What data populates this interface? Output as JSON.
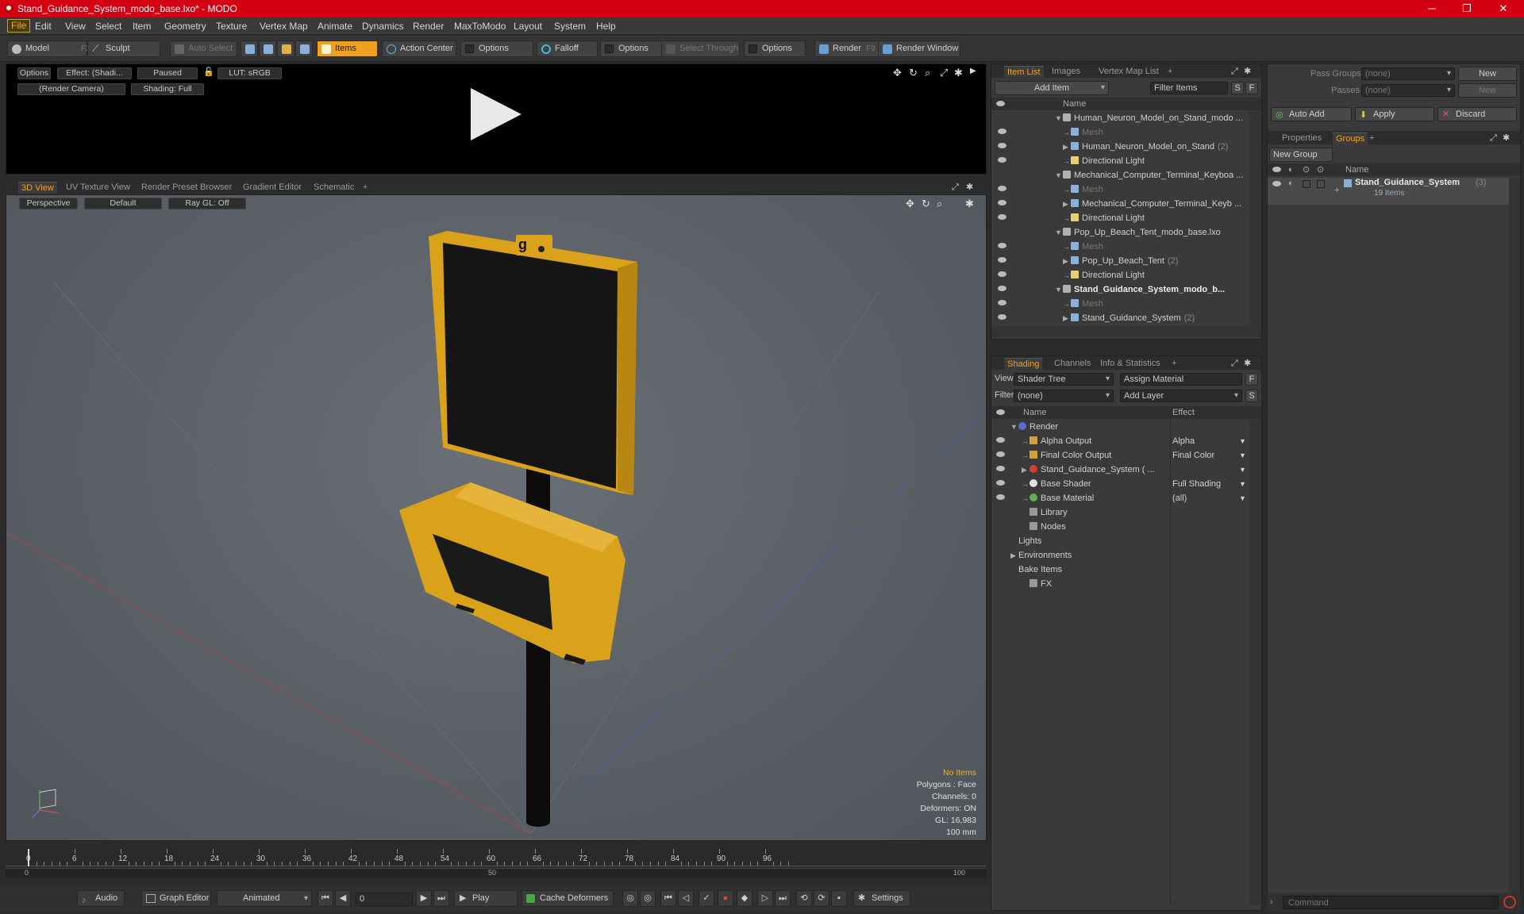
{
  "window": {
    "title": "Stand_Guidance_System_modo_base.lxo* - MODO",
    "min": "─",
    "max": "❐",
    "close": "✕"
  },
  "menu": [
    "File",
    "Edit",
    "View",
    "Select",
    "Item",
    "Geometry",
    "Texture",
    "Vertex Map",
    "Animate",
    "Dynamics",
    "Render",
    "MaxToModo",
    "Layout",
    "System",
    "Help"
  ],
  "toolbar": {
    "model": "Model",
    "model_key": "F2",
    "sculpt": "Sculpt",
    "auto_select": "Auto Select",
    "items": "Items",
    "action_center": "Action Center",
    "options1": "Options",
    "falloff": "Falloff",
    "options2": "Options",
    "select_through": "Select Through",
    "options3": "Options",
    "render": "Render",
    "render_key": "F9",
    "render_window": "Render Window"
  },
  "render_view": {
    "options": "Options",
    "effect": "Effect: (Shadi...",
    "paused": "Paused",
    "lut": "LUT: sRGB",
    "camera": "(Render Camera)",
    "shading": "Shading: Full"
  },
  "view_tabs": [
    "3D View",
    "UV Texture View",
    "Render Preset Browser",
    "Gradient Editor",
    "Schematic"
  ],
  "view3d": {
    "perspective": "Perspective",
    "default": "Default",
    "raygl": "Ray GL: Off",
    "stats": {
      "no_items": "No Items",
      "polygons": "Polygons : Face",
      "channels": "Channels: 0",
      "deformers": "Deformers: ON",
      "gl": "GL: 16,983",
      "scale": "100 mm"
    }
  },
  "timeline": {
    "ticks": [
      "0",
      "6",
      "12",
      "18",
      "24",
      "30",
      "36",
      "42",
      "48",
      "54",
      "60",
      "66",
      "72",
      "78",
      "84",
      "90",
      "96"
    ],
    "sub_start": "0",
    "sub_mid": "50",
    "sub_end": "100"
  },
  "bottom": {
    "audio": "Audio",
    "graph_editor": "Graph Editor",
    "animated": "Animated",
    "frame": "0",
    "play": "Play",
    "cache": "Cache Deformers",
    "settings": "Settings"
  },
  "item_list": {
    "tabs": [
      "Item List",
      "Images",
      "Vertex Map List"
    ],
    "add_item": "Add Item",
    "filter_items": "Filter Items",
    "s": "S",
    "f": "F",
    "col_name": "Name",
    "rows": [
      {
        "label": "Human_Neuron_Model_on_Stand_modo ...",
        "indent": 0,
        "type": "scene",
        "bold": false
      },
      {
        "label": "Mesh",
        "indent": 1,
        "type": "mesh",
        "bold": false
      },
      {
        "label": "Human_Neuron_Model_on_Stand",
        "count": "(2)",
        "indent": 1,
        "type": "group",
        "bold": false
      },
      {
        "label": "Directional Light",
        "indent": 1,
        "type": "light",
        "bold": false
      },
      {
        "label": "Mechanical_Computer_Terminal_Keyboa ...",
        "indent": 0,
        "type": "scene",
        "bold": false
      },
      {
        "label": "Mesh",
        "indent": 1,
        "type": "mesh",
        "bold": false
      },
      {
        "label": "Mechanical_Computer_Terminal_Keyb ...",
        "indent": 1,
        "type": "group",
        "bold": false
      },
      {
        "label": "Directional Light",
        "indent": 1,
        "type": "light",
        "bold": false
      },
      {
        "label": "Pop_Up_Beach_Tent_modo_base.lxo",
        "indent": 0,
        "type": "scene",
        "bold": false
      },
      {
        "label": "Mesh",
        "indent": 1,
        "type": "mesh",
        "bold": false
      },
      {
        "label": "Pop_Up_Beach_Tent",
        "count": "(2)",
        "indent": 1,
        "type": "group",
        "bold": false
      },
      {
        "label": "Directional Light",
        "indent": 1,
        "type": "light",
        "bold": false
      },
      {
        "label": "Stand_Guidance_System_modo_b...",
        "indent": 0,
        "type": "scene",
        "bold": true
      },
      {
        "label": "Mesh",
        "indent": 1,
        "type": "mesh",
        "bold": false
      },
      {
        "label": "Stand_Guidance_System",
        "count": "(2)",
        "indent": 1,
        "type": "group",
        "bold": false
      }
    ]
  },
  "shading": {
    "tabs": [
      "Shading",
      "Channels",
      "Info & Statistics"
    ],
    "view_label": "View",
    "view_value": "Shader Tree",
    "assign_material": "Assign Material",
    "f": "F",
    "filter_label": "Filter",
    "filter_value": "(none)",
    "add_layer": "Add Layer",
    "s": "S",
    "col_name": "Name",
    "col_effect": "Effect",
    "rows": [
      {
        "label": "Render",
        "effect": "",
        "indent": 0,
        "color": "#5a6ad0"
      },
      {
        "label": "Alpha Output",
        "effect": "Alpha",
        "indent": 1,
        "color": "#d0a040"
      },
      {
        "label": "Final Color Output",
        "effect": "Final Color",
        "indent": 1,
        "color": "#d0a040"
      },
      {
        "label": "Stand_Guidance_System ( ...",
        "effect": "",
        "indent": 1,
        "color": "#d04030"
      },
      {
        "label": "Base Shader",
        "effect": "Full Shading",
        "indent": 1,
        "color": "#e0e0e0"
      },
      {
        "label": "Base Material",
        "effect": "(all)",
        "indent": 1,
        "color": "#60b050"
      },
      {
        "label": "Library",
        "effect": "",
        "indent": 1,
        "color": "#999"
      },
      {
        "label": "Nodes",
        "effect": "",
        "indent": 1,
        "color": "#999"
      },
      {
        "label": "Lights",
        "effect": "",
        "indent": 0,
        "color": ""
      },
      {
        "label": "Environments",
        "effect": "",
        "indent": 0,
        "color": ""
      },
      {
        "label": "Bake Items",
        "effect": "",
        "indent": 0,
        "color": ""
      },
      {
        "label": "FX",
        "effect": "",
        "indent": 1,
        "color": "#999"
      }
    ]
  },
  "groups_panel": {
    "pass_groups": "Pass Groups",
    "passes": "Passes",
    "none": "(none)",
    "new": "New",
    "auto_add": "Auto Add",
    "apply": "Apply",
    "discard": "Discard",
    "tabs": [
      "Properties",
      "Groups"
    ],
    "new_group": "New Group",
    "col_name": "Name",
    "group_name": "Stand_Guidance_System",
    "group_count": "(3)",
    "group_items": "19 Items"
  },
  "command": {
    "placeholder": "Command"
  },
  "colors": {
    "accent": "#f0a020",
    "title_red": "#d20012",
    "model_yellow": "#e8b020"
  }
}
